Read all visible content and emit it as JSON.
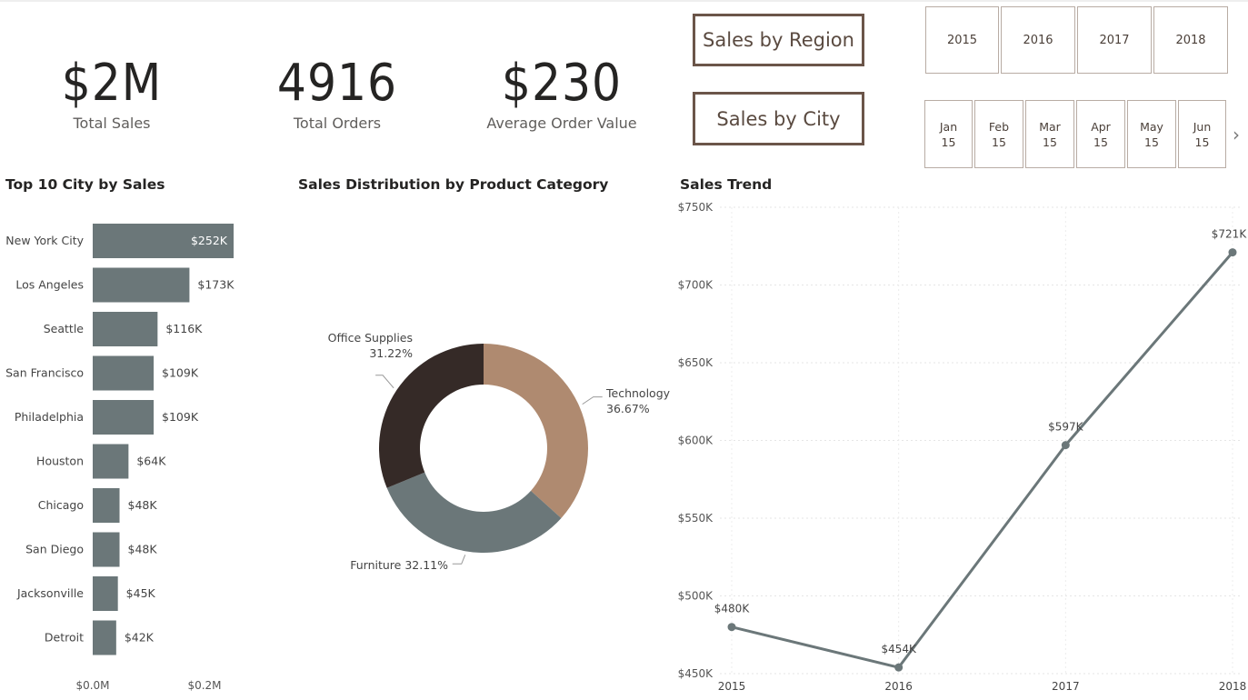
{
  "kpis": [
    {
      "value": "$2M",
      "label": "Total Sales"
    },
    {
      "value": "4916",
      "label": "Total Orders"
    },
    {
      "value": "$230",
      "label": "Average Order Value"
    }
  ],
  "nav_buttons": {
    "region": "Sales by Region",
    "city": "Sales by City"
  },
  "year_slicer": [
    "2015",
    "2016",
    "2017",
    "2018"
  ],
  "month_slicer": [
    {
      "month": "Jan",
      "year": "15"
    },
    {
      "month": "Feb",
      "year": "15"
    },
    {
      "month": "Mar",
      "year": "15"
    },
    {
      "month": "Apr",
      "year": "15"
    },
    {
      "month": "May",
      "year": "15"
    },
    {
      "month": "Jun",
      "year": "15"
    }
  ],
  "colors": {
    "bar": "#6b7779",
    "technology": "#af8a70",
    "furniture": "#6b7779",
    "office_supplies": "#352a27",
    "line": "#6b7779",
    "button_border": "#6b5549"
  },
  "chart_data": [
    {
      "type": "bar",
      "title": "Top 10 City by Sales",
      "orientation": "horizontal",
      "categories": [
        "New York City",
        "Los Angeles",
        "Seattle",
        "San Francisco",
        "Philadelphia",
        "Houston",
        "Chicago",
        "San Diego",
        "Jacksonville",
        "Detroit"
      ],
      "values": [
        252,
        173,
        116,
        109,
        109,
        64,
        48,
        48,
        45,
        42
      ],
      "value_labels": [
        "$252K",
        "$173K",
        "$116K",
        "$109K",
        "$109K",
        "$64K",
        "$48K",
        "$48K",
        "$45K",
        "$42K"
      ],
      "x_ticks": [
        "$0.0M",
        "$0.2M"
      ],
      "xlim": [
        0,
        0.2
      ],
      "unit": "K"
    },
    {
      "type": "pie",
      "variant": "donut",
      "title": "Sales Distribution by Product Category",
      "slices": [
        {
          "name": "Technology",
          "value": 36.67,
          "label": "36.67%"
        },
        {
          "name": "Furniture",
          "value": 32.11,
          "label": "32.11%"
        },
        {
          "name": "Office Supplies",
          "value": 31.22,
          "label": "31.22%"
        }
      ]
    },
    {
      "type": "line",
      "title": "Sales Trend",
      "x": [
        "2015",
        "2016",
        "2017",
        "2018"
      ],
      "values": [
        480,
        454,
        597,
        721
      ],
      "value_labels": [
        "$480K",
        "$454K",
        "$597K",
        "$721K"
      ],
      "y_ticks": [
        "$450K",
        "$500K",
        "$550K",
        "$600K",
        "$650K",
        "$700K",
        "$750K"
      ],
      "ylim": [
        450,
        750
      ],
      "grid": true
    }
  ]
}
